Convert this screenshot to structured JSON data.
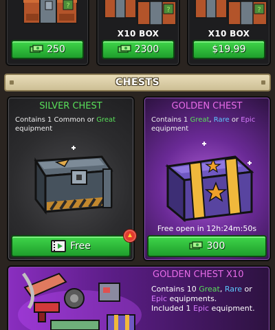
{
  "colors": {
    "green_button": "#2fbf3a",
    "silver_title": "#59e05a",
    "golden_title": "#e86ce8",
    "common_rarity_green": "#59e05a",
    "rare_blue": "#5cc8ff",
    "epic_purple": "#d97bff"
  },
  "box_offers": [
    {
      "label": "",
      "price": "250",
      "currency_icon": "cash-icon"
    },
    {
      "label": "X10 BOX",
      "price": "2300",
      "currency_icon": "cash-icon"
    },
    {
      "label": "X10 BOX",
      "price": "$19.99",
      "currency_icon": ""
    }
  ],
  "section": {
    "title": "CHESTS"
  },
  "silver_chest": {
    "title": "SILVER CHEST",
    "desc_prefix": "Contains 1 ",
    "desc_common": "Common",
    "desc_or": " or ",
    "desc_great": "Great",
    "desc_suffix": " equipment",
    "button_label": "Free",
    "button_icon": "video-ad-icon",
    "badge_icon": "alert-up-icon"
  },
  "golden_chest": {
    "title": "GOLDEN CHEST",
    "desc_prefix": "Contains 1 ",
    "desc_great": "Great",
    "desc_comma": ", ",
    "desc_rare": "Rare",
    "desc_or": " or ",
    "desc_epic": "Epic",
    "desc_suffix": " equipment",
    "free_open_text": "Free open in 12h:24m:50s",
    "price": "300",
    "currency_icon": "cash-icon"
  },
  "golden_chest_x10": {
    "title": "GOLDEN CHEST X10",
    "line1_prefix": "Contains 10 ",
    "line1_great": "Great",
    "line1_comma": ", ",
    "line1_rare": "Rare",
    "line1_or": " or",
    "line2_epic": "Epic",
    "line2_suffix": " equipments.",
    "line3_prefix": "Included 1 ",
    "line3_epic": "Epic",
    "line3_suffix": " equipment."
  }
}
